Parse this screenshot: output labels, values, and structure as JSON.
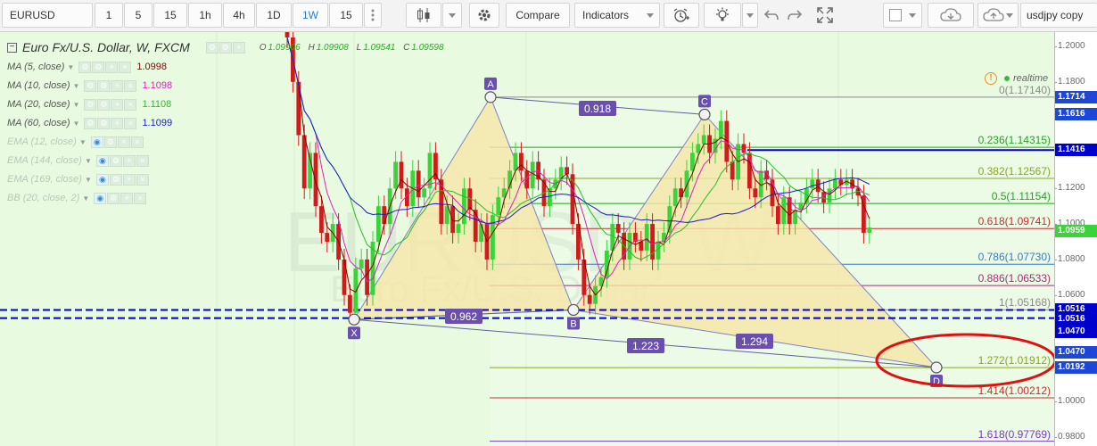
{
  "toolbar": {
    "symbol": "EURUSD",
    "intervals": [
      "1",
      "5",
      "15",
      "1h",
      "4h",
      "1D",
      "1W",
      "15"
    ],
    "active_interval": "1W",
    "compare_label": "Compare",
    "indicators_label": "Indicators",
    "layout_name": "usdjpy copy"
  },
  "legend": {
    "title": "Euro Fx/U.S. Dollar, W, FXCM",
    "ohlc": {
      "o_label": "O",
      "o": "",
      "h_label": "H",
      "h": "1.09908",
      "l_label": "L",
      "l": "1.09541",
      "c_label": "C",
      "c": "1.09598",
      "first": "1.09906"
    },
    "studies": [
      {
        "name": "MA (5, close)",
        "value": "1.0998",
        "color": "#8b0000",
        "visible": true
      },
      {
        "name": "MA (10, close)",
        "value": "1.1098",
        "color": "#e020c0",
        "visible": true
      },
      {
        "name": "MA (20, close)",
        "value": "1.1108",
        "color": "#22c022",
        "visible": true
      },
      {
        "name": "MA (60, close)",
        "value": "1.1099",
        "color": "#1a1acc",
        "visible": true
      },
      {
        "name": "EMA (12, close)",
        "value": "",
        "color": "#b8c8b8",
        "visible": false
      },
      {
        "name": "EMA (144, close)",
        "value": "",
        "color": "#b8c8b8",
        "visible": false
      },
      {
        "name": "EMA (169, close)",
        "value": "",
        "color": "#b8c8b8",
        "visible": false
      },
      {
        "name": "BB (20, close, 2)",
        "value": "",
        "color": "#b8c8b8",
        "visible": false
      }
    ]
  },
  "realtime_label": "realtime",
  "watermark": {
    "symbol": "EURUSD, W",
    "description": "Euro Fx/U.S. Dollar"
  },
  "price_scale": {
    "min": 0.975,
    "max": 1.208,
    "ticks": [
      "1.2000",
      "1.1800",
      "1.1200",
      "1.1000",
      "1.0800",
      "1.0600",
      "1.0000",
      "0.9800"
    ],
    "tick_values": [
      1.2,
      1.18,
      1.12,
      1.1,
      1.08,
      1.06,
      1.0,
      0.98
    ],
    "labels": [
      {
        "text": "1.1714",
        "value": 1.1714,
        "bg": "#1d47d8"
      },
      {
        "text": "1.1616",
        "value": 1.1616,
        "bg": "#1d47d8"
      },
      {
        "text": "1.1416",
        "value": 1.1416,
        "bg": "#0000cc"
      },
      {
        "text": "1.0959",
        "value": 1.0959,
        "bg": "#3ad43a"
      },
      {
        "text": "1.0516",
        "value": 1.0516,
        "bg": "#0000cc"
      },
      {
        "text": "1.0516",
        "value": 1.0465,
        "bg": "#0000cc"
      },
      {
        "text": "1.0470",
        "value": 1.0395,
        "bg": "#0000cc"
      },
      {
        "text": "1.0470",
        "value": 1.0275,
        "bg": "#1d47d8"
      },
      {
        "text": "1.0192",
        "value": 1.0191,
        "bg": "#1d47d8"
      }
    ]
  },
  "fib_levels": [
    {
      "text": "0(1.17140)",
      "value": 1.1714,
      "color": "#8a8a8a"
    },
    {
      "text": "0.236(1.14315)",
      "value": 1.14315,
      "color": "#1ea51e"
    },
    {
      "text": "0.382(1.12567)",
      "value": 1.12567,
      "color": "#8aa51e"
    },
    {
      "text": "0.5(1.11154)",
      "value": 1.11154,
      "color": "#1ea51e"
    },
    {
      "text": "0.618(1.09741)",
      "value": 1.09741,
      "color": "#c03030"
    },
    {
      "text": "0.786(1.07730)",
      "value": 1.0773,
      "color": "#3a7ac0"
    },
    {
      "text": "0.886(1.06533)",
      "value": 1.06533,
      "color": "#a03070"
    },
    {
      "text": "1(1.05168)",
      "value": 1.05168,
      "color": "#8a8a8a"
    },
    {
      "text": "1.272(1.01912)",
      "value": 1.01912,
      "color": "#8aa51e"
    },
    {
      "text": "1.414(1.00212)",
      "value": 1.00212,
      "color": "#c03030"
    },
    {
      "text": "1.618(0.97769)",
      "value": 0.97769,
      "color": "#7a3ac0"
    }
  ],
  "pattern": {
    "points": [
      {
        "label": "X",
        "value": 1.0462
      },
      {
        "label": "A",
        "value": 1.1714
      },
      {
        "label": "B",
        "value": 1.0516
      },
      {
        "label": "C",
        "value": 1.1616
      },
      {
        "label": "D",
        "value": 1.0192
      }
    ],
    "ratios": [
      {
        "text": "0.918",
        "between": "AC"
      },
      {
        "text": "0.962",
        "between": "XB"
      },
      {
        "text": "1.223",
        "between": "XD"
      },
      {
        "text": "1.294",
        "between": "BD"
      }
    ]
  },
  "horizontal_lines": [
    {
      "value": 1.1416,
      "color": "#0000cc",
      "style": "solid"
    },
    {
      "value": 1.0516,
      "color": "#0000cc",
      "style": "dashed"
    },
    {
      "value": 1.047,
      "color": "#0000cc",
      "style": "dashed"
    }
  ],
  "colors": {
    "up_candle": "#3ad43a",
    "down_candle": "#d01b1b",
    "background": "#e8fbe1",
    "pattern_fill": "#f6e6a8",
    "label_bg": "#6a4fae",
    "highlight_circle": "#e01010"
  }
}
